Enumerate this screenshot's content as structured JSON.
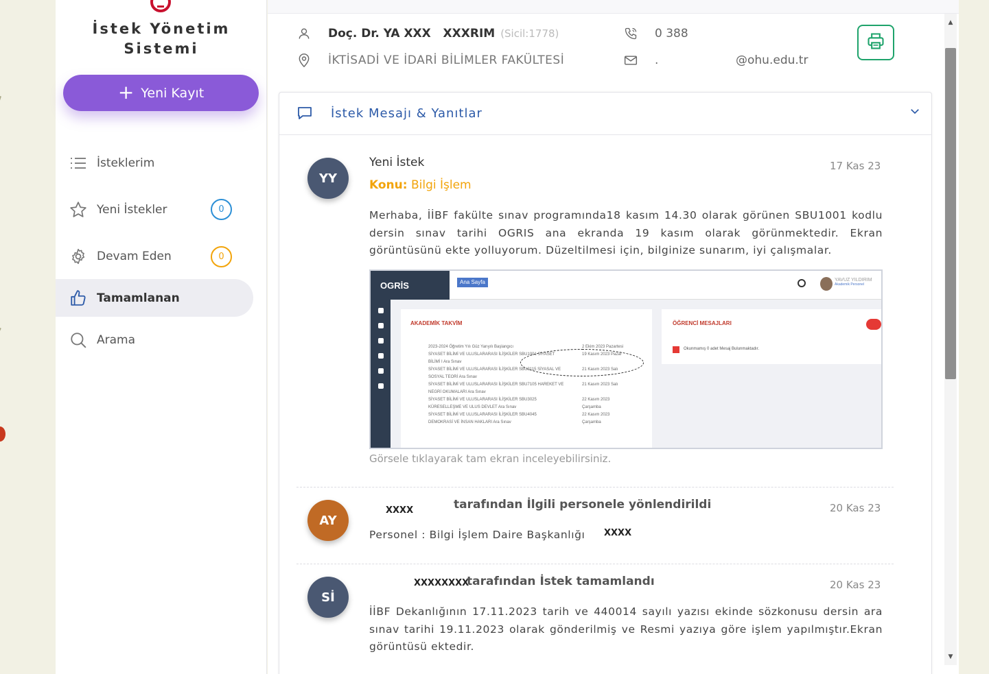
{
  "app": {
    "title_line1": "İstek Yönetim",
    "title_line2": "Sistemi",
    "new_button": "Yeni Kayıt"
  },
  "sidebar": {
    "items": [
      {
        "label": "İsteklerim",
        "icon": "list-icon"
      },
      {
        "label": "Yeni İstekler",
        "icon": "star-icon",
        "badge": "0",
        "badge_color": "#2c8fd6"
      },
      {
        "label": "Devam Eden",
        "icon": "gear-icon",
        "badge": "0",
        "badge_color": "#f2a40b"
      },
      {
        "label": "Tamamlanan",
        "icon": "thumbs-up-icon",
        "active": true
      },
      {
        "label": "Arama",
        "icon": "search-icon"
      }
    ]
  },
  "profile": {
    "name": "Doç. Dr. YA XXX   XXXRIM",
    "sicil": "(Sicil:1778)",
    "phone": "0 388",
    "faculty": "İKTİSADİ VE İDARİ BİLİMLER FAKÜLTESİ",
    "email_dot": ".",
    "email": "@ohu.edu.tr"
  },
  "section": {
    "title": "İstek Mesajı & Yanıtlar"
  },
  "messages": [
    {
      "avatar": "YY",
      "avatar_color": "#4a5872",
      "title": "Yeni İstek",
      "date": "17 Kas 23",
      "subject_label": "Konu:",
      "subject_value": "Bilgi İşlem",
      "body": "Merhaba, İİBF fakülte sınav programında18 kasım 14.30 olarak görünen SBU1001 kodlu dersin sınav tarihi OGRIS ana ekranda 19 kasım olarak görünmektedir. Ekran görüntüsünü ekte yolluyorum. Düzeltilmesi için, bilginize sunarım, iyi çalışmalar.",
      "hint": "Görsele tıklayarak tam ekran inceleyebilirsiniz."
    },
    {
      "avatar": "AY",
      "avatar_color": "#c06a25",
      "sender": "XXXX",
      "title": "tarafından İlgili personele yönlendirildi",
      "date": "20 Kas 23",
      "body": "Personel : Bilgi İşlem Daire Başkanlığı",
      "body_suffix": "XXXX"
    },
    {
      "avatar": "Sİ",
      "avatar_color": "#4a5872",
      "sender": "XXXXXXXX",
      "title": "tarafından İstek tamamlandı",
      "date": "20 Kas 23",
      "body": "İİBF Dekanlığının 17.11.2023 tarih ve 440014 sayılı yazısı ekinde sözkonusu dersin ara sınav tarihi 19.11.2023 olarak gönderilmiş ve Resmi yazıya göre işlem yapılmıştır.Ekran görüntüsü ektedir."
    }
  ],
  "attachment": {
    "brand": "OGRİS",
    "crumb": "Ana Sayfa",
    "user": "YAVUZ YILDIRIM",
    "user_role": "Akademik Personel",
    "panel_title": "AKADEMİK TAKVİM",
    "panel2_title": "ÖĞRENCİ MESAJLARI",
    "panel2_line": "Okunmamış 0 adet Mesaj Bulunmaktadır.",
    "rows": [
      {
        "left": "2023-2024 Öğretim Yılı Güz Yarıyılı Başlangıcı",
        "right": "2 Ekim 2023 Pazartesi"
      },
      {
        "left": "SİYASET BİLİMİ VE ULUSLARARASI İLİŞKİLER SBU1001 SİYASET",
        "right": "19 Kasım 2023 Pazar"
      },
      {
        "left": "BİLİMİ I Ara Sınav",
        "right": ""
      },
      {
        "left": "SİYASET BİLİMİ VE ULUSLARARASI İLİŞKİLER SBU3115 SİYASAL VE",
        "right": "21 Kasım 2023 Salı"
      },
      {
        "left": "SOSYAL TEORİ Ara Sınav",
        "right": ""
      },
      {
        "left": "SİYASET BİLİMİ VE ULUSLARARASI İLİŞKİLER SBU7105 HAREKET VE",
        "right": "21 Kasım 2023 Salı"
      },
      {
        "left": "NEGRİ OKUMALARI Ara Sınav",
        "right": ""
      },
      {
        "left": "SİYASET BİLİMİ VE ULUSLARARASI İLİŞKİLER SBU3025",
        "right": "22 Kasım 2023"
      },
      {
        "left": "KÜRESELLEŞME VE ULUS DEVLET Ara Sınav",
        "right": "Çarşamba"
      },
      {
        "left": "SİYASET BİLİMİ VE ULUSLARARASI İLİŞKİLER SBU4045",
        "right": "22 Kasım 2023"
      },
      {
        "left": "DEMOKRASİ VE İNSAN HAKLARI Ara Sınav",
        "right": "Çarşamba"
      }
    ]
  }
}
